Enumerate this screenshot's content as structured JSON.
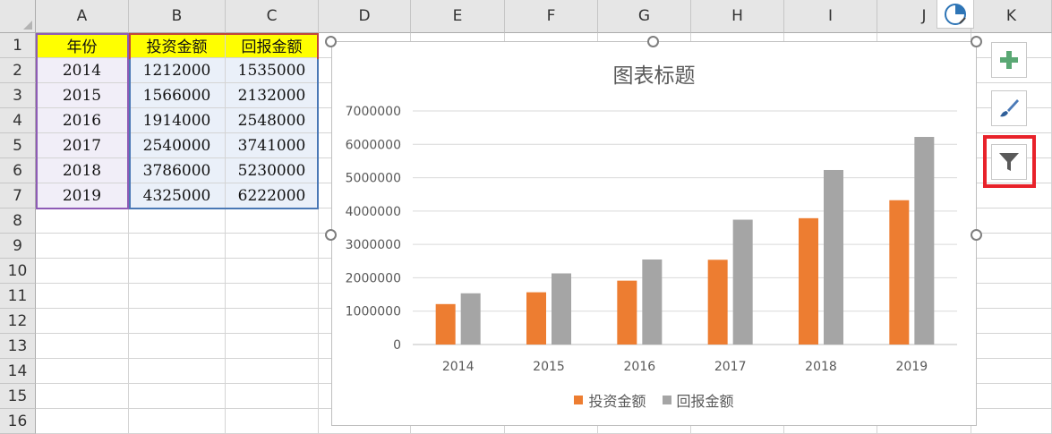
{
  "columns": [
    "A",
    "B",
    "C",
    "D",
    "E",
    "F",
    "G",
    "H",
    "I",
    "J",
    "K"
  ],
  "rows": [
    "1",
    "2",
    "3",
    "4",
    "5",
    "6",
    "7",
    "8",
    "9",
    "10",
    "11",
    "12",
    "13",
    "14",
    "15",
    "16"
  ],
  "table": {
    "headers": [
      "年份",
      "投资金额",
      "回报金额"
    ],
    "data": [
      [
        "2014",
        "1212000",
        "1535000"
      ],
      [
        "2015",
        "1566000",
        "2132000"
      ],
      [
        "2016",
        "1914000",
        "2548000"
      ],
      [
        "2017",
        "2540000",
        "3741000"
      ],
      [
        "2018",
        "3786000",
        "5230000"
      ],
      [
        "2019",
        "4325000",
        "6222000"
      ]
    ]
  },
  "colors": {
    "header_fill": "#ffff00",
    "series_invest": "#ed7d31",
    "series_return": "#a5a5a5",
    "highlight": "#e8222a"
  },
  "side_buttons": [
    {
      "icon": "plus-icon"
    },
    {
      "icon": "brush-icon"
    },
    {
      "icon": "filter-icon"
    }
  ],
  "chart_data": {
    "type": "bar",
    "title": "图表标题",
    "categories": [
      "2014",
      "2015",
      "2016",
      "2017",
      "2018",
      "2019"
    ],
    "series": [
      {
        "name": "投资金额",
        "values": [
          1212000,
          1566000,
          1914000,
          2540000,
          3786000,
          4325000
        ],
        "color": "#ed7d31"
      },
      {
        "name": "回报金额",
        "values": [
          1535000,
          2132000,
          2548000,
          3741000,
          5230000,
          6222000
        ],
        "color": "#a5a5a5"
      }
    ],
    "yticks": [
      "0",
      "1000000",
      "2000000",
      "3000000",
      "4000000",
      "5000000",
      "6000000",
      "7000000"
    ],
    "ylim": [
      0,
      7000000
    ],
    "grid": true,
    "legend": "bottom"
  }
}
